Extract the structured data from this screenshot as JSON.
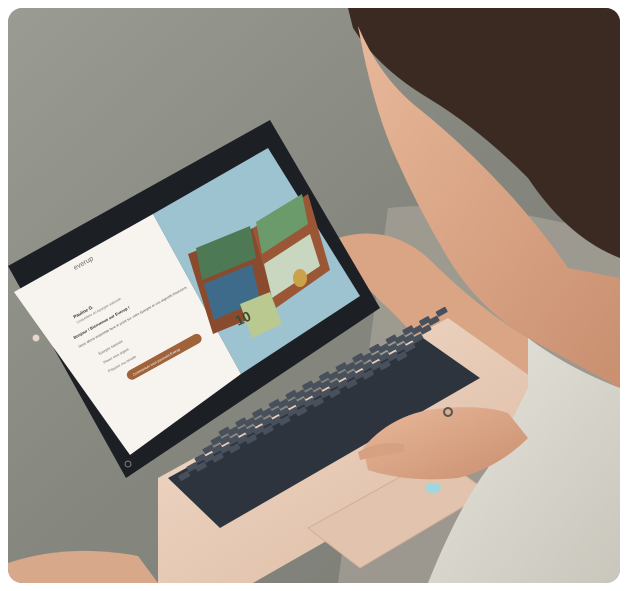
{
  "screen": {
    "brand": "everup",
    "user_name": "Pauline G.",
    "user_subtitle": "Conseillère en épargne salariale",
    "greeting": "Bonjour ! Bienvenue sur Everup !",
    "intro": "Nous allons ensemble faire le point sur votre épargne et vos objectifs financiers.",
    "options": [
      "Épargne salariale",
      "Placer mon argent",
      "Préparer ma retraite"
    ],
    "cta": "Commencer mon parcours Everup",
    "banknote_value": "10"
  },
  "colors": {
    "accent": "#a0623a",
    "illustration_bg": "#9dc3d1",
    "wallet": "#8a4a2e",
    "laptop_body": "#e9cdb8",
    "keys": "#3c4450"
  }
}
